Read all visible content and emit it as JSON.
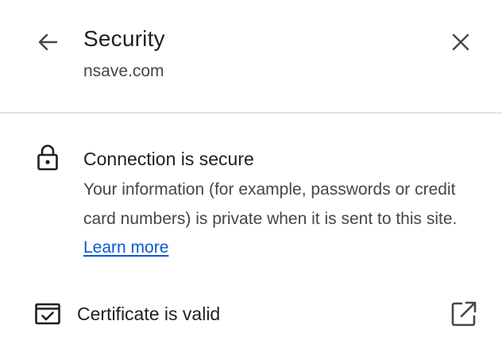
{
  "header": {
    "title": "Security",
    "site": "nsave.com"
  },
  "connection": {
    "icon": "lock-icon",
    "title": "Connection is secure",
    "description": "Your information (for example, passwords or credit card numbers) is private when it is sent to this site.",
    "learn_more_label": "Learn more"
  },
  "certificate": {
    "icon": "certificate-icon",
    "label": "Certificate is valid",
    "action_icon": "open-external-icon"
  },
  "colors": {
    "text_primary": "#1f1f1f",
    "text_secondary": "#444746",
    "link": "#0b57d0",
    "divider": "#dde3ea"
  }
}
